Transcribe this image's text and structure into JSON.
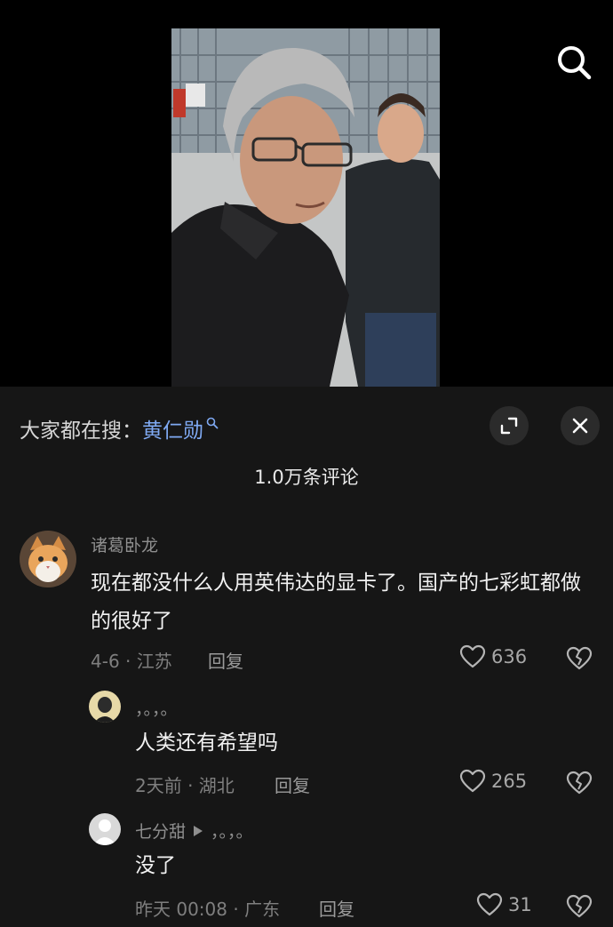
{
  "video": {
    "subject": "video-frame"
  },
  "header_icons": {
    "search": "search-icon"
  },
  "panel": {
    "trending_prefix": "大家都在搜：",
    "trending_keyword": "黄仁勋",
    "comment_count": "1.0万条评论",
    "icons": {
      "expand": "expand-icon",
      "close": "close-icon"
    }
  },
  "comments": [
    {
      "username": "诸葛卧龙",
      "text": "现在都没什么人用英伟达的显卡了。国产的七彩虹都做的很好了",
      "meta": "4-6 · 江苏",
      "reply": "回复",
      "likes": "636"
    },
    {
      "username": "，。，。",
      "text": "人类还有希望吗",
      "meta": "2天前 · 湖北",
      "reply": "回复",
      "likes": "265"
    },
    {
      "username": "七分甜",
      "reply_to": "，。，。",
      "text": "没了",
      "meta": "昨天 00:08 · 广东",
      "reply": "回复",
      "likes": "31"
    }
  ],
  "colors": {
    "panel_bg": "#161616",
    "keyword": "#7fa9f2",
    "muted": "#8e8e8e"
  }
}
